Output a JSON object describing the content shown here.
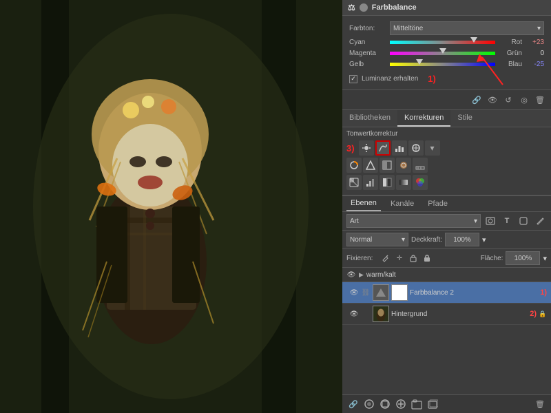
{
  "window": {
    "title": "Farbbalance"
  },
  "left_panel": {
    "image_alt": "Scarecrow character photo"
  },
  "right_panel": {
    "farbbalance": {
      "title": "Farbbalance",
      "farbton_label": "Farbton:",
      "farbton_value": "Mitteltöne",
      "sliders": [
        {
          "label_left": "Cyan",
          "label_right": "Rot",
          "value": "+23",
          "thumb_percent": 80,
          "track_type": "cyan-red"
        },
        {
          "label_left": "Magenta",
          "label_right": "Grün",
          "value": "0",
          "thumb_percent": 50,
          "track_type": "magenta-green"
        },
        {
          "label_left": "Gelb",
          "label_right": "Blau",
          "value": "-25",
          "thumb_percent": 28,
          "track_type": "yellow-blue"
        }
      ],
      "luminanz_label": "Luminanz erhalten",
      "luminanz_checked": true,
      "annotation_1": "1)"
    },
    "icons_bar": {
      "icons": [
        "link",
        "eye",
        "refresh",
        "eye2",
        "trash"
      ]
    },
    "tabs": [
      {
        "id": "bibliotheken",
        "label": "Bibliotheken"
      },
      {
        "id": "korrekturen",
        "label": "Korrekturen",
        "active": true
      },
      {
        "id": "stile",
        "label": "Stile"
      }
    ],
    "korrekturen": {
      "title": "Tonwertkorrektur",
      "annotation_3": "3)",
      "row1_icons": [
        "brightness",
        "curves",
        "levels",
        "curves2",
        "arrow-down"
      ],
      "row2_icons": [
        "hue-sat",
        "color-balance",
        "black-white",
        "photo-filter",
        "channel-mixer"
      ],
      "row3_icons": [
        "invert",
        "posterize",
        "threshold",
        "gradient-map",
        "selective-color"
      ]
    },
    "ebenen": {
      "tabs": [
        {
          "label": "Ebenen",
          "active": true
        },
        {
          "label": "Kanäle"
        },
        {
          "label": "Pfade"
        }
      ],
      "art_label": "Art",
      "art_dropdown_icon": "▾",
      "icons": [
        "photo",
        "text",
        "shape",
        "pen"
      ],
      "blend_mode": "Normal",
      "blend_mode_icon": "▾",
      "deckkraft_label": "Deckkraft:",
      "deckkraft_value": "100%",
      "fixieren_label": "Fixieren:",
      "fix_icons": [
        "pencil",
        "move",
        "lock-partial",
        "lock"
      ],
      "flaeche_label": "Fläche:",
      "flaeche_value": "100%",
      "layers": [
        {
          "type": "group",
          "name": "warm/kalt",
          "expanded": false,
          "visible": true
        },
        {
          "type": "layer",
          "name": "Farbbalance 2",
          "annotation": "1)",
          "visible": true,
          "active": true,
          "has_mask": true
        },
        {
          "type": "layer",
          "name": "Hintergrund",
          "annotation": "2)",
          "visible": true,
          "active": false,
          "is_background": true,
          "locked": true
        }
      ]
    },
    "bottom_bar": {
      "icons": [
        "link",
        "add-style",
        "mask",
        "adjustment",
        "group",
        "add-layer",
        "trash"
      ]
    }
  }
}
